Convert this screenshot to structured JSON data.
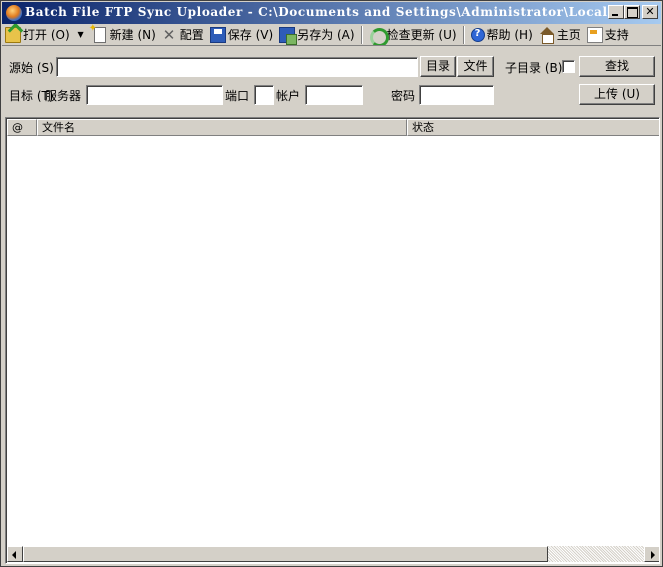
{
  "window": {
    "title": "Batch File FTP Sync Uploader - C:\\Documents and Settings\\Administrator\\Local Set..."
  },
  "toolbar": {
    "open": "打开 (O)",
    "new": "新建 (N)",
    "config": "配置",
    "save": "保存 (V)",
    "save_as": "另存为 (A)",
    "check_update": "检查更新 (U)",
    "help": "帮助 (H)",
    "home": "主页",
    "support": "支持"
  },
  "form": {
    "source_label": "源始 (S)",
    "source_value": "",
    "dir_button": "目录",
    "file_button": "文件",
    "subdir_label": "子目录 (B)",
    "find_button": "查找",
    "target_label": "目标 (T)",
    "server_label": "服务器",
    "server_value": "",
    "port_label": "端口",
    "port_value": "",
    "account_label": "帐户",
    "account_value": "",
    "password_label": "密码",
    "password_value": "",
    "upload_button": "上传 (U)"
  },
  "list": {
    "columns": [
      "@",
      "文件名",
      "状态"
    ]
  },
  "colors": {
    "titlebar_start": "#0a246a",
    "titlebar_end": "#a6caf0",
    "face": "#d4d0c8"
  }
}
